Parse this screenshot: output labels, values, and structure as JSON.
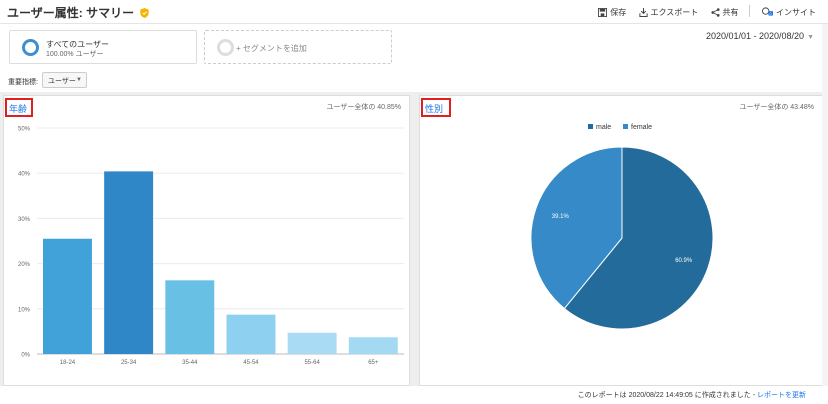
{
  "header": {
    "title": "ユーザー属性: サマリー",
    "actions": [
      {
        "icon": "save-icon",
        "label": "保存"
      },
      {
        "icon": "export-icon",
        "label": "エクスポート"
      },
      {
        "icon": "share-icon",
        "label": "共有"
      },
      {
        "icon": "insight-icon",
        "label": "インサイト"
      }
    ]
  },
  "segments": {
    "active_name": "すべてのユーザー",
    "active_sub": "100.00% ユーザー",
    "add_label": "+ セグメントを追加"
  },
  "date_range": "2020/01/01 - 2020/08/20",
  "metric": {
    "label": "重要指標:",
    "selected": "ユーザー"
  },
  "age_panel": {
    "title": "年齢",
    "stat": "ユーザー全体の 40.85%"
  },
  "gender_panel": {
    "title": "性別",
    "stat": "ユーザー全体の 43.48%"
  },
  "footer": {
    "text": "このレポートは 2020/08/22 14:49:05 に作成されました - ",
    "link": "レポートを更新"
  },
  "colors": {
    "accent": "#1a73e8",
    "highlight": "#e02020",
    "male": "#236b9a",
    "female": "#378ac8"
  },
  "chart_data": [
    {
      "type": "bar",
      "categories": [
        "18-24",
        "25-34",
        "35-44",
        "45-54",
        "55-64",
        "65+"
      ],
      "values": [
        25.5,
        40.4,
        16.3,
        8.7,
        4.7,
        3.7
      ],
      "colors": [
        "#41a2da",
        "#2f87c7",
        "#69c0e5",
        "#8ed0ef",
        "#a9dcf4",
        "#a3d9f2"
      ],
      "yticks": [
        "0%",
        "10%",
        "20%",
        "30%",
        "40%",
        "50%"
      ],
      "ylim": [
        0,
        50
      ],
      "grid": true
    },
    {
      "type": "pie",
      "labels": [
        "male",
        "female"
      ],
      "values": [
        60.9,
        39.1
      ],
      "value_labels": [
        "60.9%",
        "39.1%"
      ],
      "colors": [
        "#236b9a",
        "#378ac8"
      ],
      "legend": "top"
    }
  ]
}
